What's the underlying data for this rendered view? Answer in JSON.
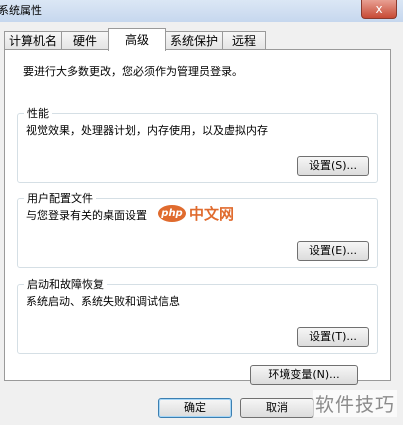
{
  "window": {
    "title": "系统属性",
    "close_glyph": "x"
  },
  "tabs": [
    {
      "label": "计算机名",
      "active": false
    },
    {
      "label": "硬件",
      "active": false
    },
    {
      "label": "高级",
      "active": true
    },
    {
      "label": "系统保护",
      "active": false
    },
    {
      "label": "远程",
      "active": false
    }
  ],
  "panel": {
    "notice": "要进行大多数更改，您必须作为管理员登录。",
    "performance": {
      "title": "性能",
      "description": "视觉效果，处理器计划，内存使用，以及虚拟内存",
      "button": "设置(S)..."
    },
    "user_profiles": {
      "title": "用户配置文件",
      "description": "与您登录有关的桌面设置",
      "button": "设置(E)..."
    },
    "startup_recovery": {
      "title": "启动和故障恢复",
      "description": "系统启动、系统失败和调试信息",
      "button": "设置(T)..."
    },
    "env_button": "环境变量(N)..."
  },
  "footer": {
    "ok": "确定",
    "cancel": "取消"
  },
  "watermarks": {
    "center_logo": "php",
    "center_text": "中文网",
    "corner_text": "软件技巧"
  }
}
